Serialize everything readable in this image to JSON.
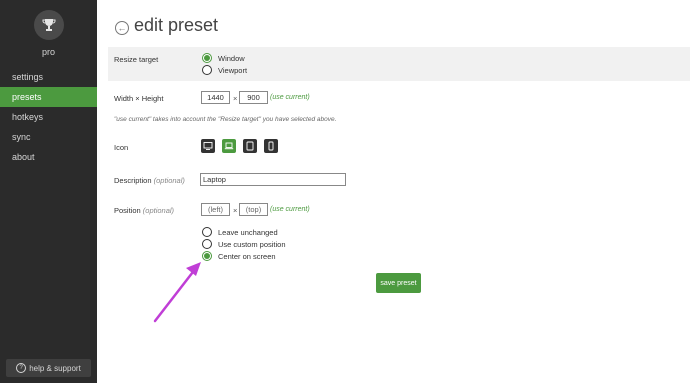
{
  "sidebar": {
    "user_name": "pro",
    "items": [
      {
        "label": "settings"
      },
      {
        "label": "presets"
      },
      {
        "label": "hotkeys"
      },
      {
        "label": "sync"
      },
      {
        "label": "about"
      }
    ],
    "active_item": "presets",
    "help_label": "help & support"
  },
  "header": {
    "title": "edit preset"
  },
  "form": {
    "resize_target": {
      "label": "Resize target",
      "options": [
        "Window",
        "Viewport"
      ],
      "selected": "Window"
    },
    "size": {
      "label": "Width × Height",
      "width": "1440",
      "times": "×",
      "height": "900",
      "use_current": "(use current)",
      "note": "\"use current\" takes into account the \"Resize target\" you have selected above."
    },
    "icon": {
      "label": "Icon",
      "options": [
        "desktop-icon",
        "laptop-icon",
        "tablet-icon",
        "phone-icon"
      ],
      "selected": "laptop-icon"
    },
    "description": {
      "label": "Description",
      "optional": "(optional)",
      "value": "Laptop"
    },
    "position": {
      "label": "Position",
      "optional": "(optional)",
      "left_placeholder": "(left)",
      "times": "×",
      "top_placeholder": "(top)",
      "use_current": "(use current)",
      "options": [
        "Leave unchanged",
        "Use custom position",
        "Center on screen"
      ],
      "selected": "Center on screen"
    },
    "save_label": "save preset"
  },
  "colors": {
    "accent": "#4c9a3f",
    "sidebar_bg": "#2b2b2b",
    "annotation_arrow": "#c03ed6"
  }
}
